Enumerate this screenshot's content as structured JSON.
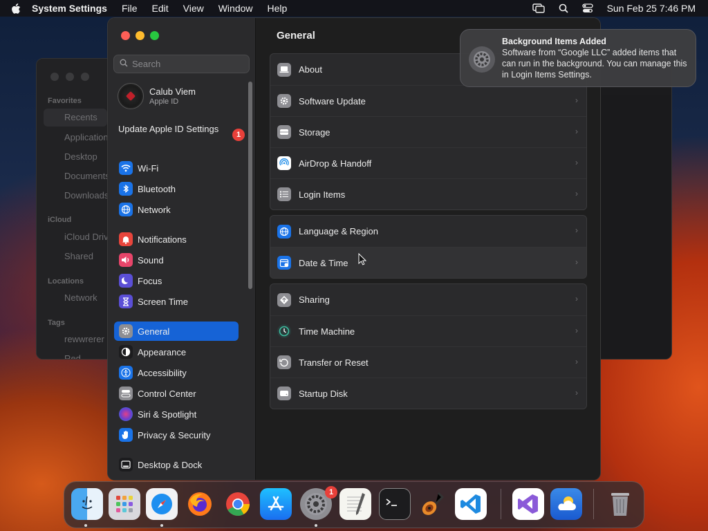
{
  "menubar": {
    "app_name": "System Settings",
    "items": [
      "File",
      "Edit",
      "View",
      "Window",
      "Help"
    ],
    "datetime": "Sun Feb 25  7:46 PM"
  },
  "finder": {
    "sections": [
      {
        "header": "Favorites",
        "items": [
          "Recents",
          "Applications",
          "Desktop",
          "Documents",
          "Downloads"
        ]
      },
      {
        "header": "iCloud",
        "items": [
          "iCloud Drive",
          "Shared"
        ]
      },
      {
        "header": "Locations",
        "items": [
          "Network"
        ]
      },
      {
        "header": "Tags",
        "items": [
          "rewwrerer",
          "Red"
        ]
      }
    ]
  },
  "settings": {
    "search_placeholder": "Search",
    "account": {
      "name": "Calub Viem",
      "subtitle": "Apple ID"
    },
    "update": {
      "label": "Update Apple ID Settings",
      "badge": "1"
    },
    "sidebar_items": [
      {
        "label": "Wi-Fi",
        "icon": "wifi-icon",
        "color": "#1a73e8"
      },
      {
        "label": "Bluetooth",
        "icon": "bluetooth-icon",
        "color": "#1a73e8"
      },
      {
        "label": "Network",
        "icon": "globe-icon",
        "color": "#1a73e8"
      },
      {
        "label": "Notifications",
        "icon": "bell-icon",
        "color": "#e8453c"
      },
      {
        "label": "Sound",
        "icon": "speaker-icon",
        "color": "#e8456a"
      },
      {
        "label": "Focus",
        "icon": "moon-icon",
        "color": "#5b4fd6"
      },
      {
        "label": "Screen Time",
        "icon": "hourglass-icon",
        "color": "#5b4fd6"
      },
      {
        "label": "General",
        "icon": "gear-icon",
        "color": "#8e8e93",
        "active": true
      },
      {
        "label": "Appearance",
        "icon": "appearance-icon",
        "color": "#1c1c1e"
      },
      {
        "label": "Accessibility",
        "icon": "accessibility-icon",
        "color": "#1a73e8"
      },
      {
        "label": "Control Center",
        "icon": "control-center-icon",
        "color": "#8e8e93"
      },
      {
        "label": "Siri & Spotlight",
        "icon": "siri-icon",
        "color": "#6a3fd0"
      },
      {
        "label": "Privacy & Security",
        "icon": "hand-icon",
        "color": "#1a73e8"
      },
      {
        "label": "Desktop & Dock",
        "icon": "dock-icon",
        "color": "#1c1c1e"
      }
    ],
    "main_title": "General",
    "groups": [
      [
        {
          "label": "About",
          "icon": "laptop-icon"
        },
        {
          "label": "Software Update",
          "icon": "gear-badge-icon"
        },
        {
          "label": "Storage",
          "icon": "drive-icon"
        },
        {
          "label": "AirDrop & Handoff",
          "icon": "airdrop-icon"
        },
        {
          "label": "Login Items",
          "icon": "list-icon"
        }
      ],
      [
        {
          "label": "Language & Region",
          "icon": "globe-icon"
        },
        {
          "label": "Date & Time",
          "icon": "calendar-icon"
        }
      ],
      [
        {
          "label": "Sharing",
          "icon": "sharing-icon"
        },
        {
          "label": "Time Machine",
          "icon": "time-machine-icon"
        },
        {
          "label": "Transfer or Reset",
          "icon": "reset-icon"
        },
        {
          "label": "Startup Disk",
          "icon": "disk-icon"
        }
      ]
    ]
  },
  "notification": {
    "title": "Background Items Added",
    "body": "Software from “Google LLC” added items that can run in the background. You can manage this in Login Items Settings."
  },
  "dock": {
    "apps": [
      "Finder",
      "Launchpad",
      "Safari",
      "Firefox",
      "Chrome",
      "App Store",
      "System Settings",
      "TextEdit",
      "Terminal",
      "GarageBand",
      "Visual Studio Code",
      "Visual Studio",
      "Weather",
      "Trash"
    ],
    "settings_badge": "1"
  }
}
